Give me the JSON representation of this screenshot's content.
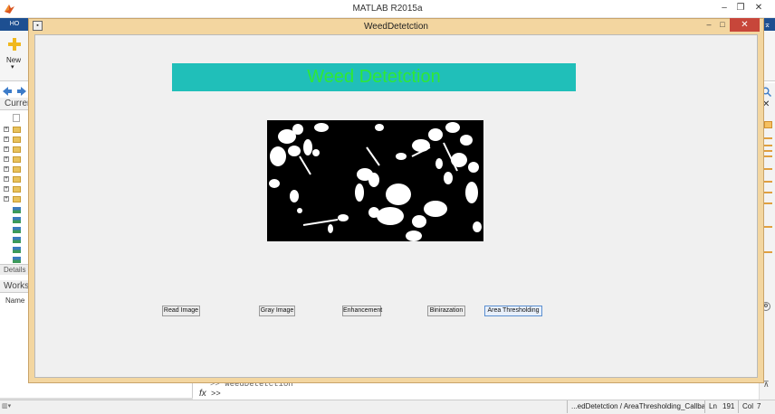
{
  "matlab": {
    "title": "MATLAB R2015a",
    "ribbon_tab": "HO",
    "new_label": "New",
    "current_folder_header": "Curren",
    "details_label": "Details",
    "workspace_header": "Works",
    "workspace_name_col": "Name",
    "command_echo": ">> WeedDetetction",
    "command_fx": "fx",
    "command_prompt": ">>",
    "window_controls": {
      "minimize": "–",
      "restore": "❐",
      "close": "✕"
    }
  },
  "figure": {
    "title": "WeedDetetction",
    "banner_text": "Weed Detetction",
    "banner_color": "#20bfb9",
    "banner_text_color": "#2ee836",
    "buttons": {
      "read": "Read Image",
      "gray": "Gray Image",
      "enhance": "Enhancement",
      "binarize": "Binirazation",
      "area": "Area Thresholding"
    },
    "controls": {
      "minimize": "–",
      "maximize": "□",
      "close": "✕"
    }
  },
  "status_bar": {
    "callback": "...edDetetction / AreaThresholding_Callback",
    "ln_label": "Ln",
    "ln_value": "191",
    "col_label": "Col",
    "col_value": "7"
  },
  "icons": {
    "matlab_logo": "matlab-logo-icon",
    "new": "new-plus-icon",
    "search": "search-icon",
    "close": "close-icon"
  }
}
